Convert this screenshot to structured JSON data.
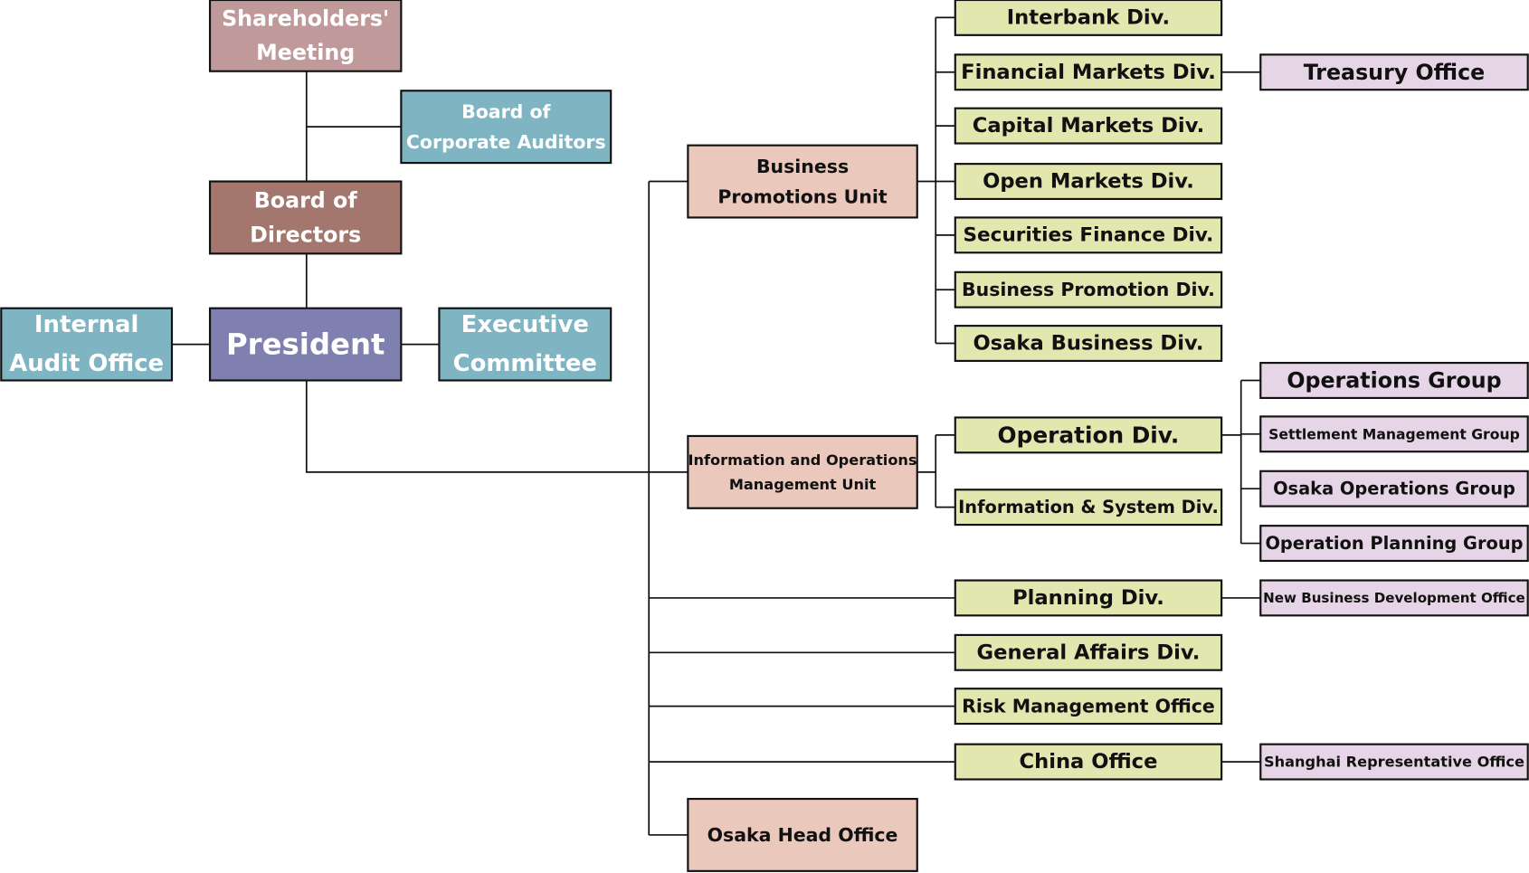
{
  "colors": {
    "shareholders": "#c09a9a",
    "directors": "#a3766e",
    "teal": "#7fb5c3",
    "president": "#7f80b0",
    "unit": "#ebc8bc",
    "division": "#e2e7b0",
    "group": "#e6d5e6",
    "line": "#111111"
  },
  "nodes": {
    "shareholders": {
      "lines": [
        "Shareholders'",
        "Meeting"
      ]
    },
    "auditors": {
      "lines": [
        "Board of",
        "Corporate Auditors"
      ]
    },
    "directors": {
      "lines": [
        "Board of",
        "Directors"
      ]
    },
    "internal_audit": {
      "lines": [
        "Internal",
        "Audit Office"
      ]
    },
    "president": {
      "lines": [
        "President"
      ]
    },
    "executive": {
      "lines": [
        "Executive",
        "Committee"
      ]
    },
    "bpu": {
      "lines": [
        "Business",
        "Promotions Unit"
      ]
    },
    "iomu": {
      "lines": [
        "Information and Operations",
        "Management Unit"
      ]
    },
    "osaka_head": {
      "lines": [
        "Osaka Head Office"
      ]
    },
    "interbank": {
      "lines": [
        "Interbank Div."
      ]
    },
    "fin_markets": {
      "lines": [
        "Financial Markets Div."
      ]
    },
    "cap_markets": {
      "lines": [
        "Capital Markets Div."
      ]
    },
    "open_markets": {
      "lines": [
        "Open Markets Div."
      ]
    },
    "sec_finance": {
      "lines": [
        "Securities Finance Div."
      ]
    },
    "bus_promo": {
      "lines": [
        "Business Promotion Div."
      ]
    },
    "osaka_bus": {
      "lines": [
        "Osaka Business Div."
      ]
    },
    "operation": {
      "lines": [
        "Operation Div."
      ]
    },
    "info_sys": {
      "lines": [
        "Information & System Div."
      ]
    },
    "planning": {
      "lines": [
        "Planning Div."
      ]
    },
    "general": {
      "lines": [
        "General Affairs Div."
      ]
    },
    "risk": {
      "lines": [
        "Risk Management Office"
      ]
    },
    "china": {
      "lines": [
        "China Office"
      ]
    },
    "treasury": {
      "lines": [
        "Treasury Office"
      ]
    },
    "ops_group": {
      "lines": [
        "Operations Group"
      ]
    },
    "settlement": {
      "lines": [
        "Settlement Management Group"
      ]
    },
    "osaka_ops": {
      "lines": [
        "Osaka Operations Group"
      ]
    },
    "op_planning": {
      "lines": [
        "Operation Planning Group"
      ]
    },
    "new_biz": {
      "lines": [
        "New Business Development Office"
      ]
    },
    "shanghai": {
      "lines": [
        "Shanghai Representative Office"
      ]
    }
  }
}
